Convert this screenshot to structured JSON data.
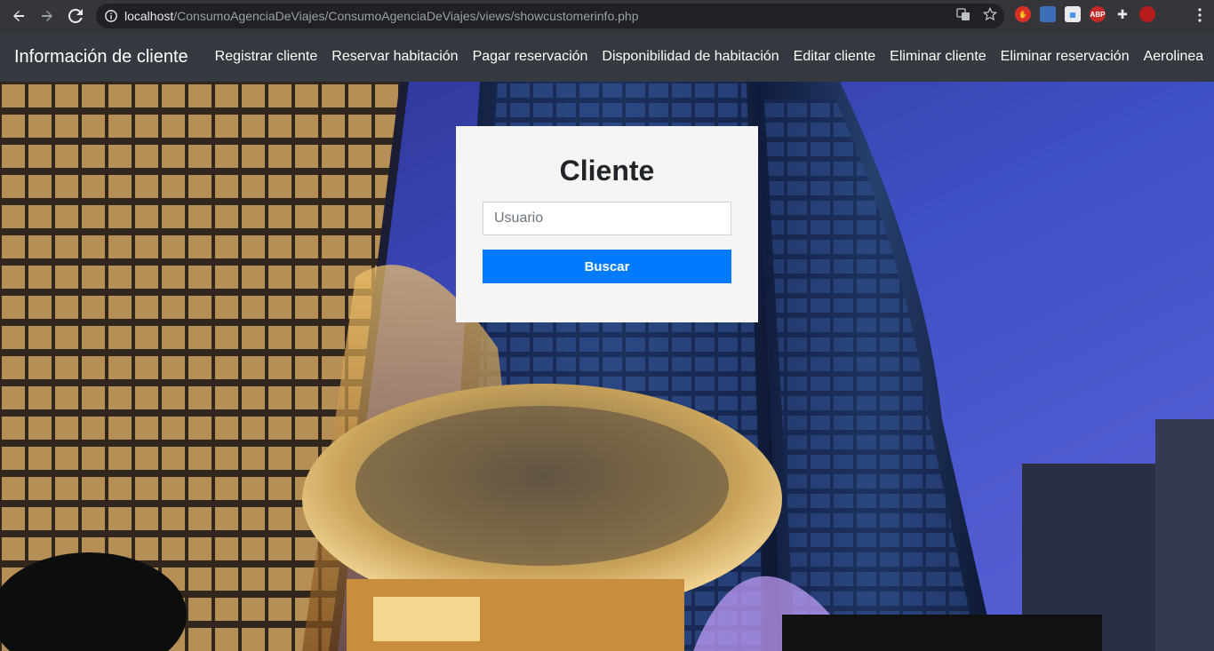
{
  "browser": {
    "url_host": "localhost",
    "url_path": "/ConsumoAgenciaDeViajes/ConsumoAgenciaDeViajes/views/showcustomerinfo.php",
    "extensions": [
      "shield-ext",
      "screen-ext",
      "doc-ext",
      "ABP",
      "puzzle-ext",
      "profile-avatar"
    ]
  },
  "navbar": {
    "brand": "Información de cliente",
    "links": [
      "Registrar cliente",
      "Reservar habitación",
      "Pagar reservación",
      "Disponibilidad de habitación",
      "Editar cliente",
      "Eliminar cliente",
      "Eliminar reservación",
      "Aerolinea"
    ]
  },
  "card": {
    "title": "Cliente",
    "input_placeholder": "Usuario",
    "button_label": "Buscar"
  },
  "colors": {
    "navbar": "#343a40",
    "card": "#f5f5f5",
    "primary": "#007bff"
  }
}
